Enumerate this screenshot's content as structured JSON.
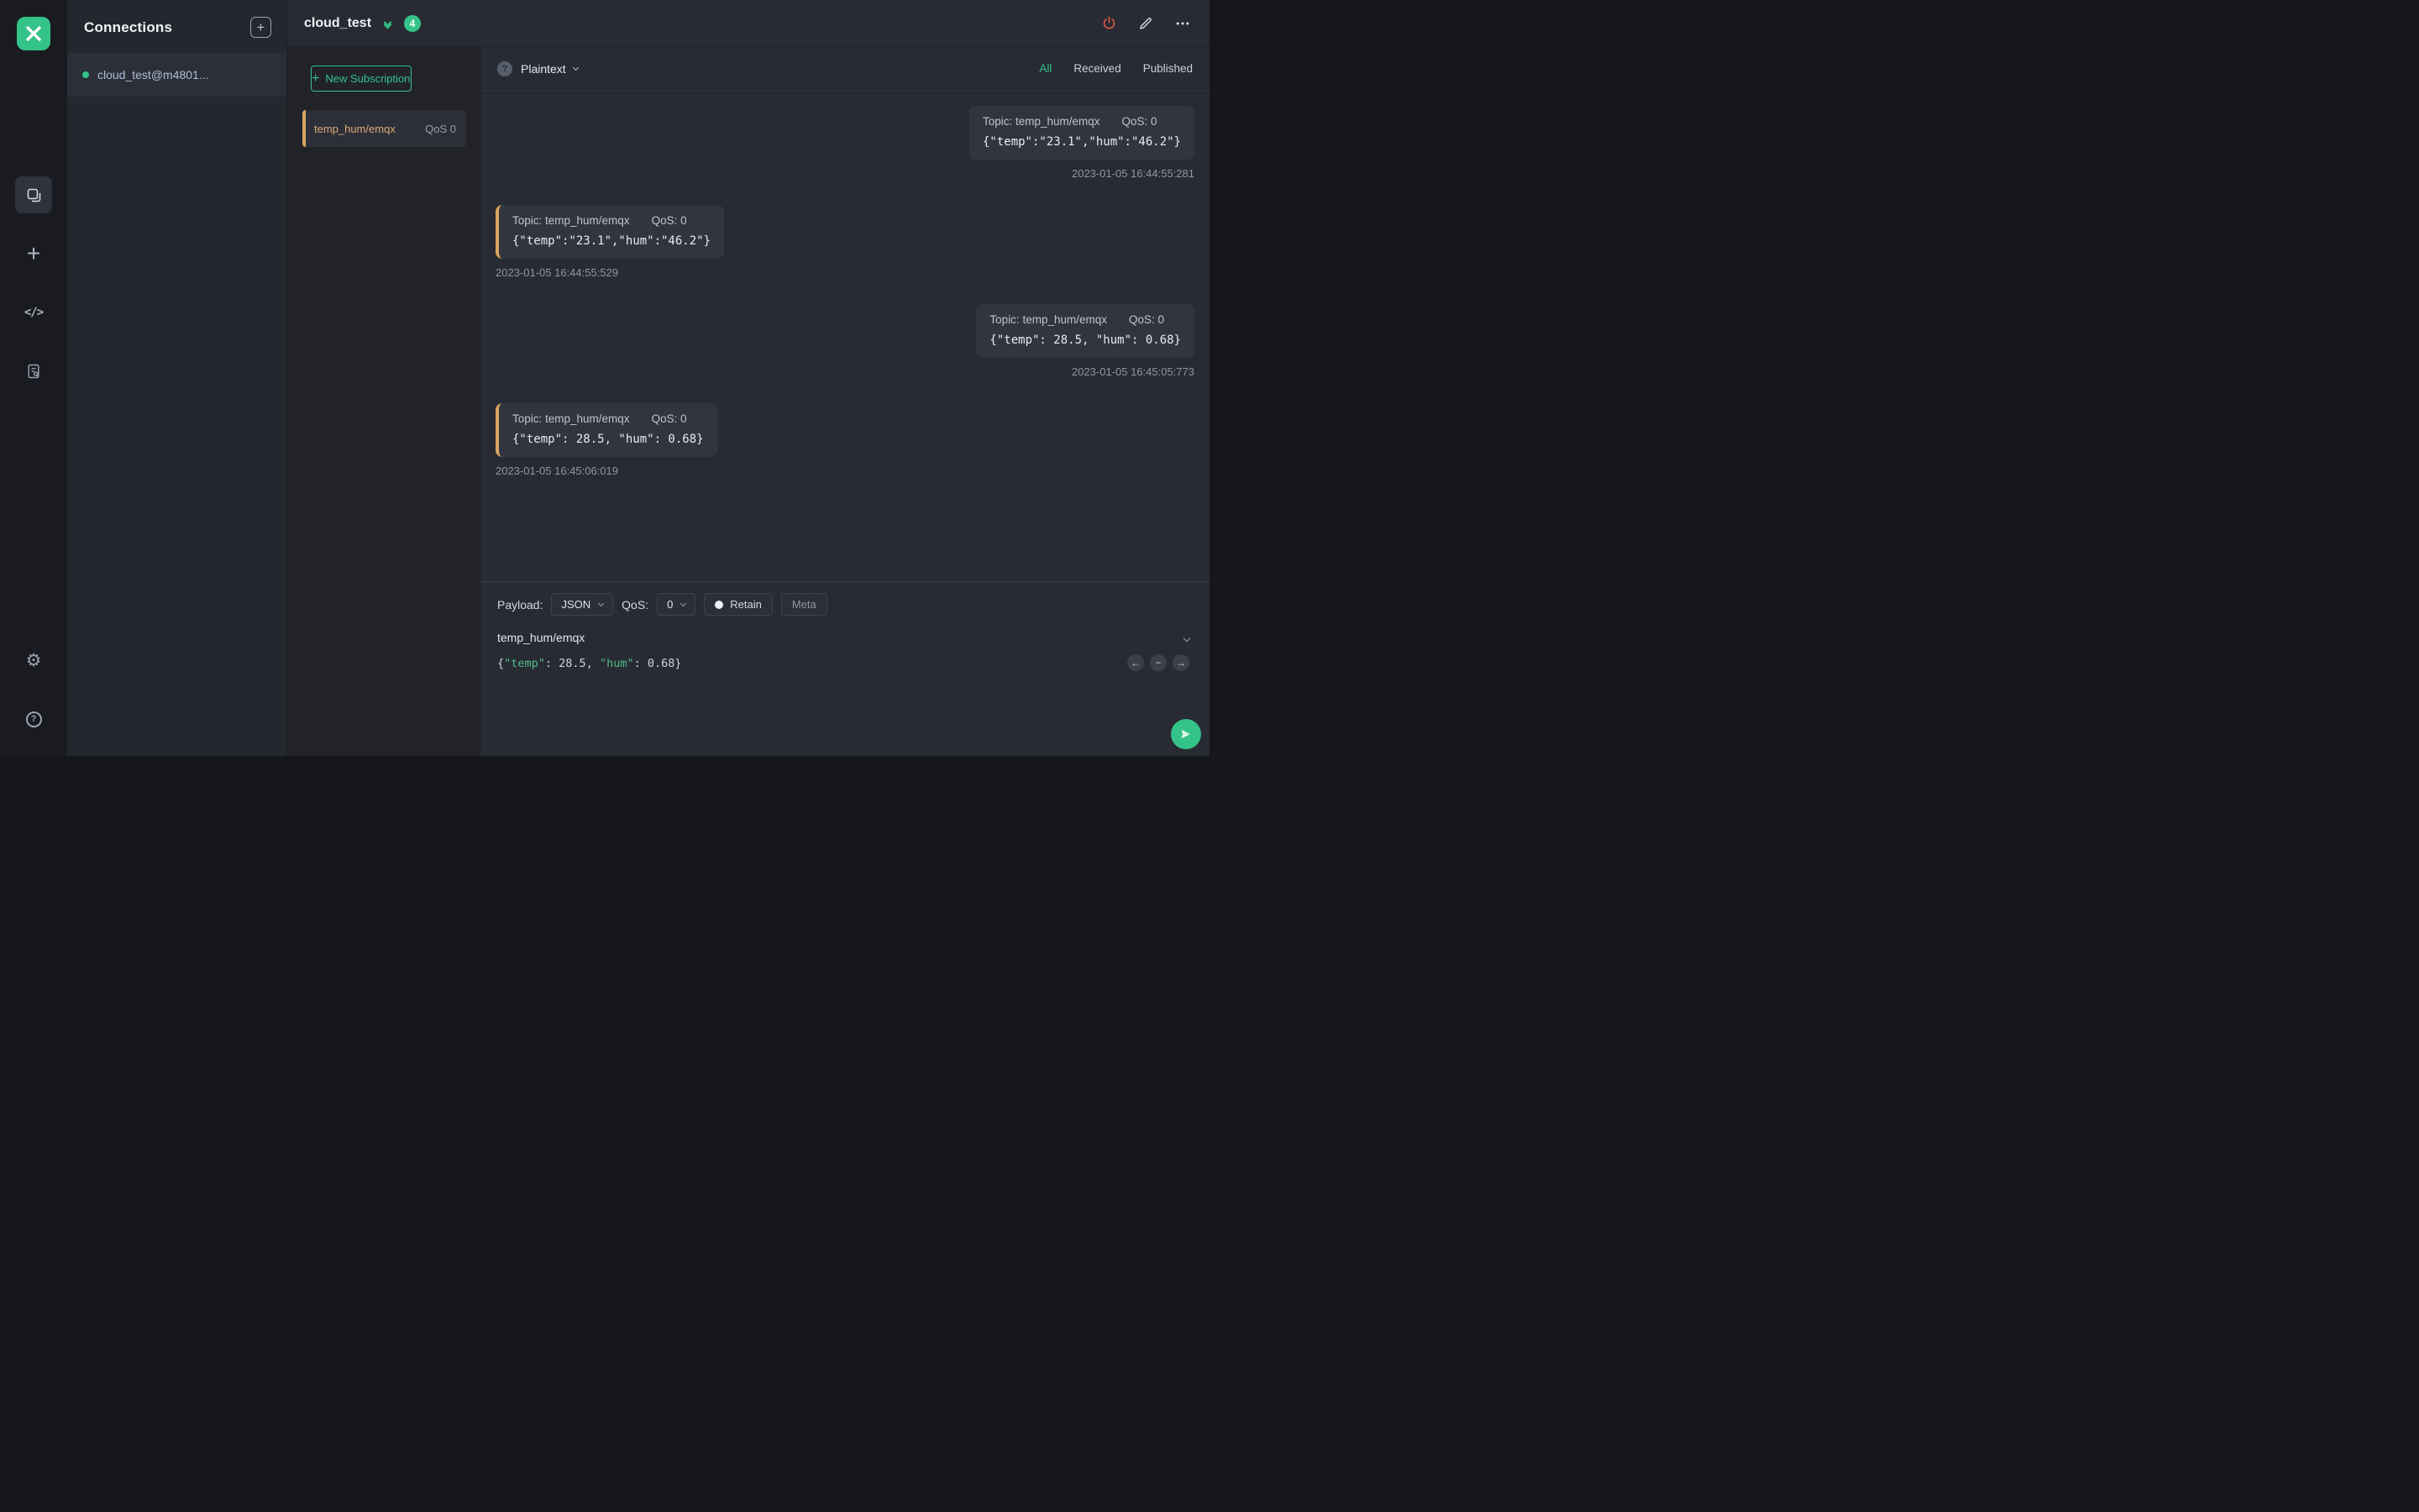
{
  "colors": {
    "accent_green": "#34c388",
    "subscription_orange": "#d9a462",
    "power_red": "#e25b4c",
    "background_dark": "#282b33"
  },
  "rail": {
    "plus_glyph": "+",
    "code_glyph": "</>",
    "gear_glyph": "⚙",
    "help_glyph": "?"
  },
  "connections": {
    "title": "Connections",
    "new_button_glyph": "+",
    "items": [
      {
        "label": "cloud_test@m4801..."
      }
    ]
  },
  "header": {
    "title": "cloud_test",
    "badge_count": "4"
  },
  "subscriptions": {
    "new_button_plus": "+",
    "new_button_label": "New Subscription",
    "items": [
      {
        "topic": "temp_hum/emqx",
        "qos": "QoS 0"
      }
    ]
  },
  "toolbar": {
    "help_glyph": "?",
    "format_label": "Plaintext",
    "tabs": [
      {
        "label": "All",
        "active": true
      },
      {
        "label": "Received",
        "active": false
      },
      {
        "label": "Published",
        "active": false
      }
    ]
  },
  "messages": [
    {
      "direction": "published",
      "topic": "Topic: temp_hum/emqx",
      "qos": "QoS: 0",
      "payload": "{\"temp\":\"23.1\",\"hum\":\"46.2\"}",
      "time": "2023-01-05 16:44:55:281"
    },
    {
      "direction": "received",
      "topic": "Topic: temp_hum/emqx",
      "qos": "QoS: 0",
      "payload": "{\"temp\":\"23.1\",\"hum\":\"46.2\"}",
      "time": "2023-01-05 16:44:55:529"
    },
    {
      "direction": "published",
      "topic": "Topic: temp_hum/emqx",
      "qos": "QoS: 0",
      "payload": "{\"temp\": 28.5, \"hum\": 0.68}",
      "time": "2023-01-05 16:45:05:773"
    },
    {
      "direction": "received",
      "topic": "Topic: temp_hum/emqx",
      "qos": "QoS: 0",
      "payload": "{\"temp\": 28.5, \"hum\": 0.68}",
      "time": "2023-01-05 16:45:06:019"
    }
  ],
  "publish": {
    "payload_label": "Payload:",
    "payload_format": "JSON",
    "qos_label": "QoS:",
    "qos_value": "0",
    "retain_label": "Retain",
    "meta_label": "Meta",
    "topic": "temp_hum/emqx",
    "editor": {
      "brace": "{",
      "key1": "\"temp\"",
      "val1": ": 28.5, ",
      "key2": "\"hum\"",
      "val2": ": 0.68}"
    },
    "nav": {
      "prev": "←",
      "minus": "−",
      "next": "→"
    }
  }
}
